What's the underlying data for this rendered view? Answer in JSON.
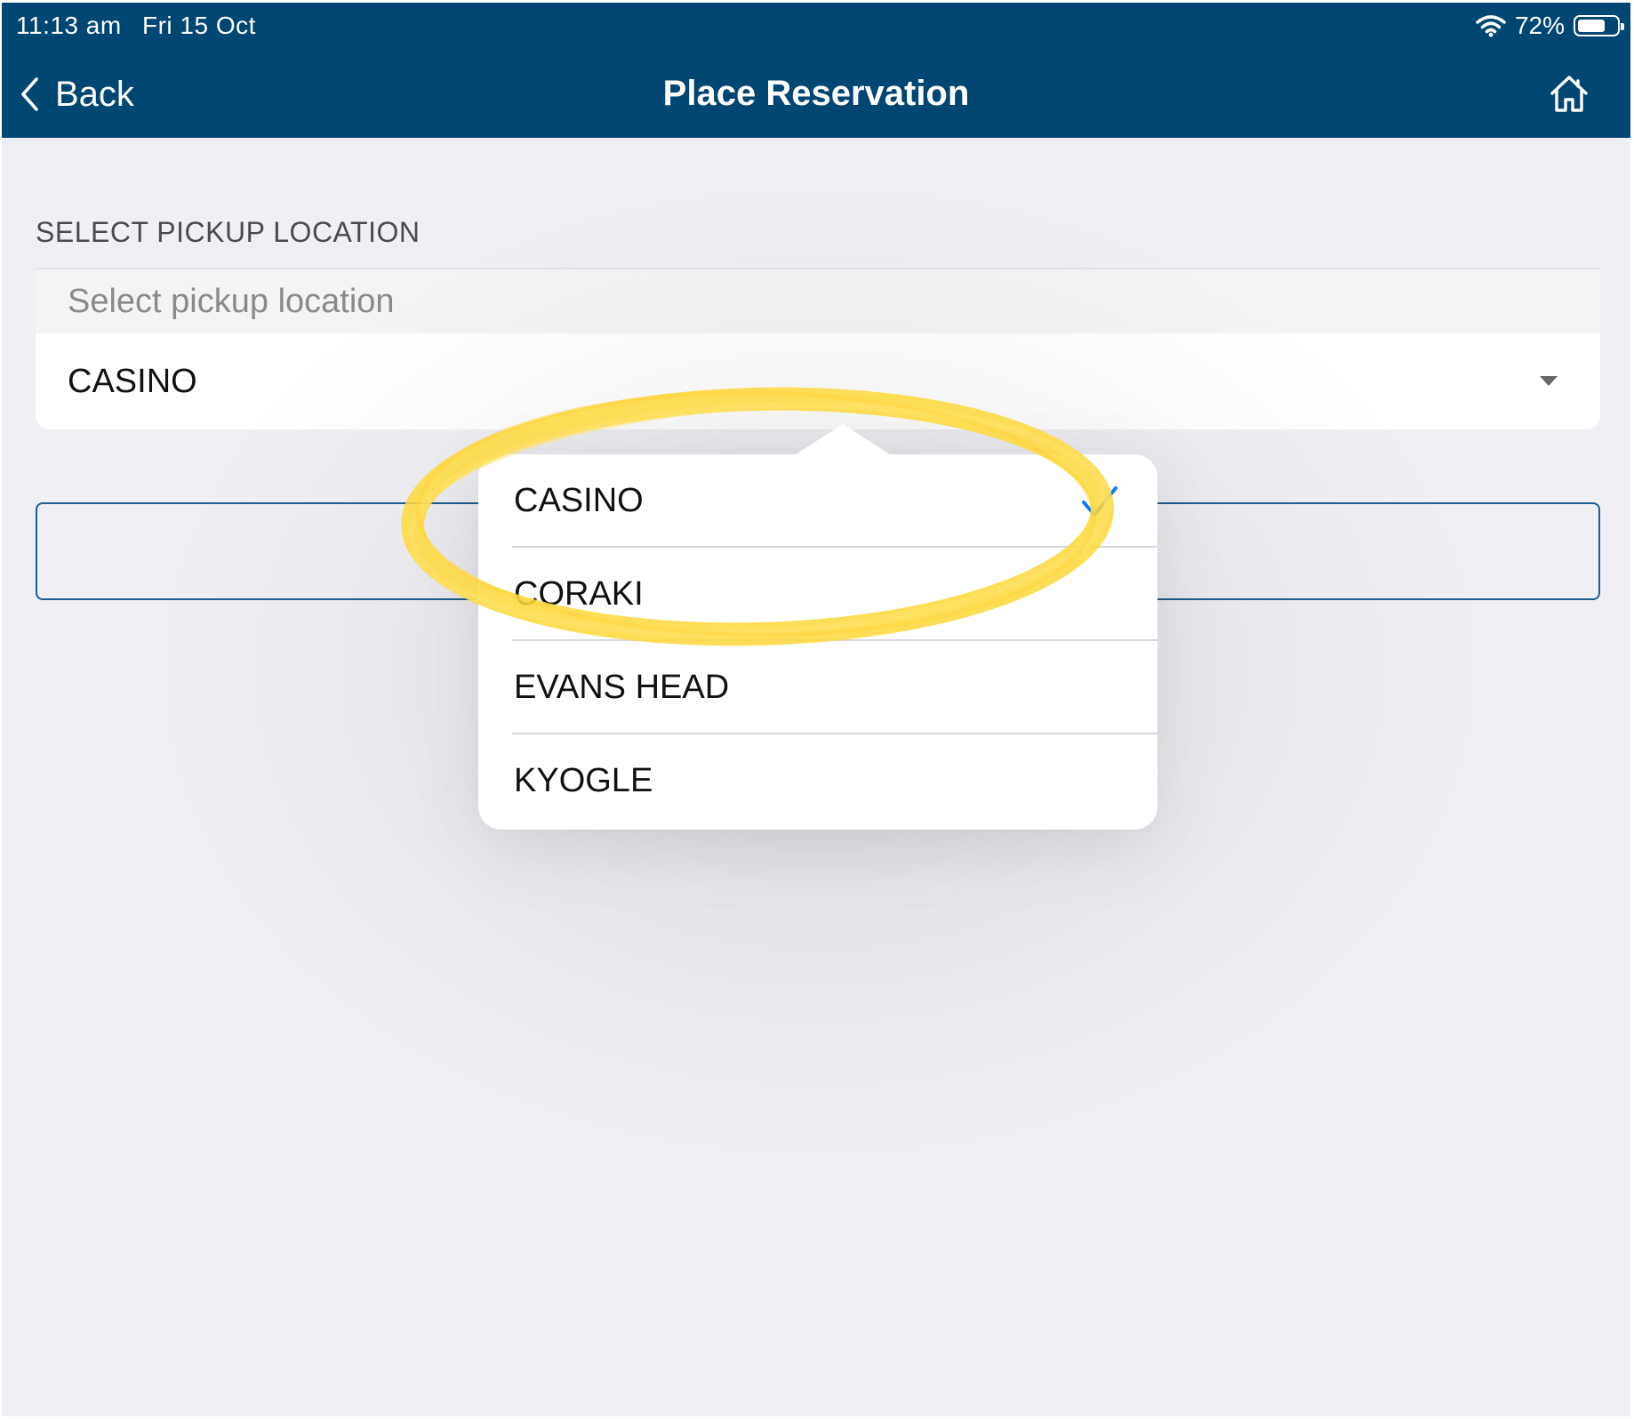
{
  "status_bar": {
    "time": "11:13 am",
    "date": "Fri 15 Oct",
    "battery_percent": "72%",
    "battery_level": 0.72
  },
  "nav": {
    "back_label": "Back",
    "title": "Place Reservation",
    "icons": {
      "back": "chevron-left-icon",
      "home": "home-icon"
    }
  },
  "pickup": {
    "section_label": "SELECT PICKUP LOCATION",
    "placeholder": "Select pickup location",
    "selected_value": "CASINO"
  },
  "dropdown": {
    "options": [
      {
        "label": "CASINO",
        "selected": true
      },
      {
        "label": "CORAKI",
        "selected": false
      },
      {
        "label": "EVANS HEAD",
        "selected": false
      },
      {
        "label": "KYOGLE",
        "selected": false
      }
    ]
  },
  "colors": {
    "nav_background": "#004672",
    "accent_blue": "#0a7aff",
    "highlight_yellow": "#ffd83a",
    "page_background": "#efeff4"
  }
}
